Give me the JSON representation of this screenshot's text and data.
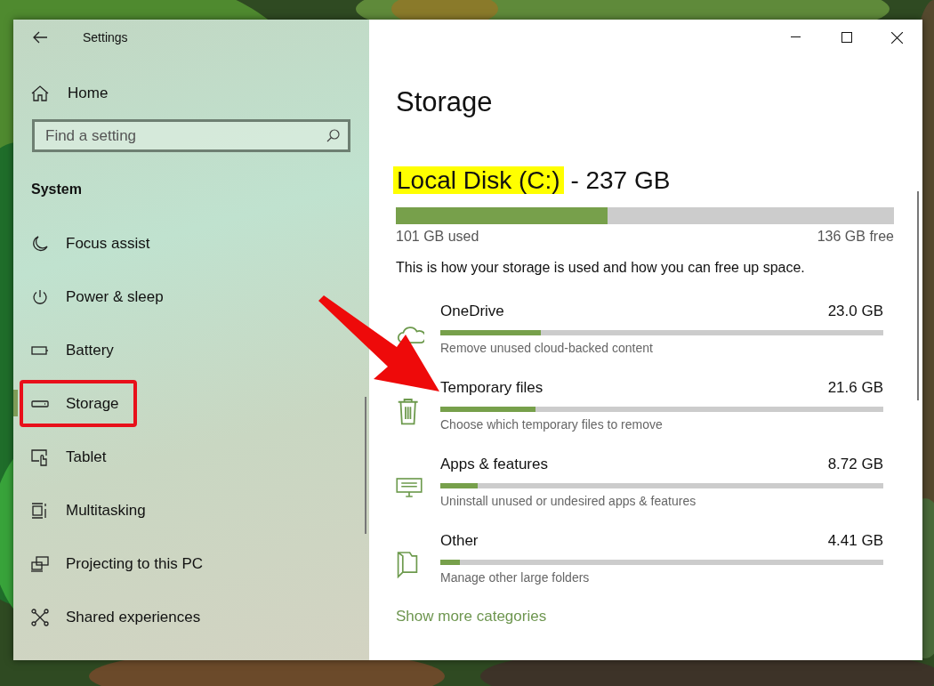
{
  "window": {
    "title": "Settings"
  },
  "sidebar": {
    "home": "Home",
    "search": {
      "placeholder": "Find a setting"
    },
    "section": "System",
    "items": [
      {
        "kind": "focus",
        "label": "Focus assist",
        "selected": false,
        "annotated": false
      },
      {
        "kind": "power",
        "label": "Power & sleep",
        "selected": false,
        "annotated": false
      },
      {
        "kind": "battery",
        "label": "Battery",
        "selected": false,
        "annotated": false
      },
      {
        "kind": "storage",
        "label": "Storage",
        "selected": true,
        "annotated": true
      },
      {
        "kind": "tablet",
        "label": "Tablet",
        "selected": false,
        "annotated": false
      },
      {
        "kind": "multitask",
        "label": "Multitasking",
        "selected": false,
        "annotated": false
      },
      {
        "kind": "project",
        "label": "Projecting to this PC",
        "selected": false,
        "annotated": false
      },
      {
        "kind": "shared",
        "label": "Shared experiences",
        "selected": false,
        "annotated": false
      }
    ]
  },
  "content": {
    "title": "Storage",
    "drive": {
      "name": "Local Disk (C:)",
      "highlighted": true,
      "size": "- 237 GB",
      "level": 0.425,
      "used": "101 GB used",
      "free": "136 GB free"
    },
    "intro": "This is how your storage is used and how you can free up space.",
    "categories": [
      {
        "kind": "cloud",
        "name": "OneDrive",
        "size": "23.0 GB",
        "level": 0.227,
        "description": "Remove unused cloud-backed content"
      },
      {
        "kind": "trash",
        "name": "Temporary files",
        "size": "21.6 GB",
        "level": 0.215,
        "description": "Choose which temporary files to remove"
      },
      {
        "kind": "apps",
        "name": "Apps & features",
        "size": "8.72 GB",
        "level": 0.084,
        "description": "Uninstall unused or undesired apps & features"
      },
      {
        "kind": "other",
        "name": "Other",
        "size": "4.41 GB",
        "level": 0.044,
        "description": "Manage other large folders"
      }
    ],
    "link": "Show more categories"
  }
}
